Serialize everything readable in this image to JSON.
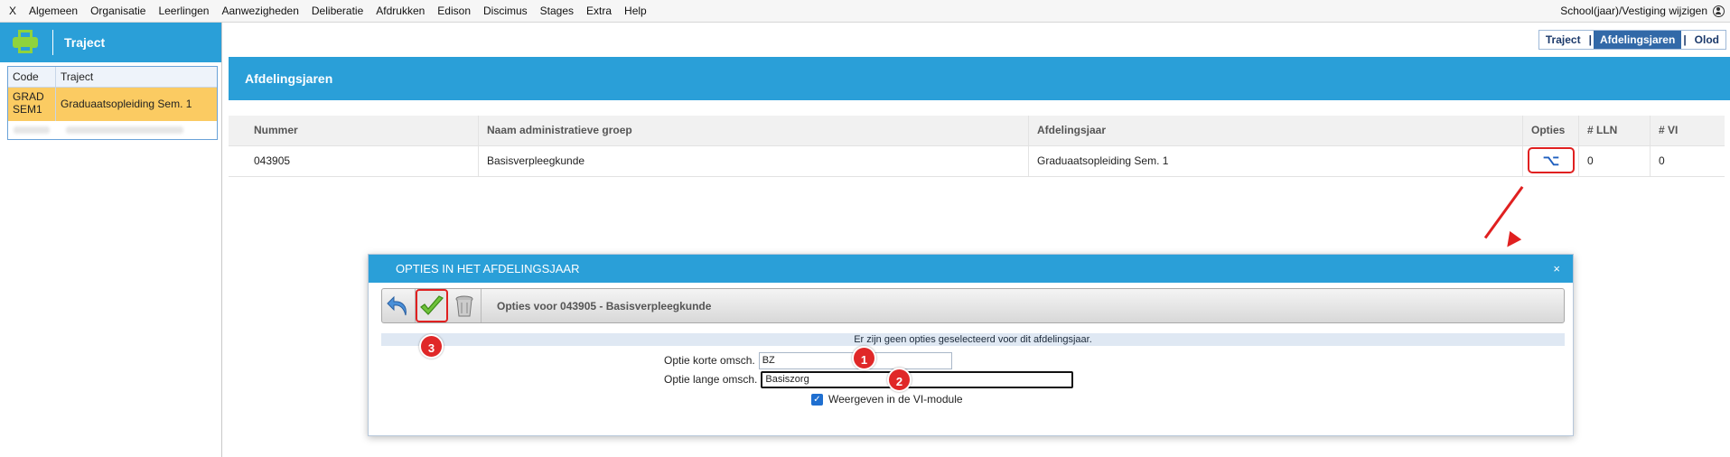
{
  "menu": {
    "items": [
      "X",
      "Algemeen",
      "Organisatie",
      "Leerlingen",
      "Aanwezigheden",
      "Deliberatie",
      "Afdrukken",
      "Edison",
      "Discimus",
      "Stages",
      "Extra",
      "Help"
    ],
    "right_label": "School(jaar)/Vestiging wijzigen"
  },
  "left": {
    "title": "Traject",
    "table": {
      "headers": [
        "Code",
        "Traject"
      ],
      "rows": [
        {
          "code": "GRAD SEM1",
          "traject": "Graduaatsopleiding Sem. 1"
        }
      ]
    }
  },
  "tabs": {
    "items": [
      "Traject",
      "Afdelingsjaren",
      "Olod"
    ],
    "active": "Afdelingsjaren"
  },
  "main": {
    "title": "Afdelingsjaren",
    "table": {
      "headers": [
        "Nummer",
        "Naam administratieve groep",
        "Afdelingsjaar",
        "Opties",
        "# LLN",
        "# VI"
      ],
      "rows": [
        {
          "nummer": "043905",
          "naam": "Basisverpleegkunde",
          "afdelingsjaar": "Graduaatsopleiding Sem. 1",
          "opties_icon": "⌥",
          "lln": "0",
          "vi": "0"
        }
      ]
    }
  },
  "dialog": {
    "title": "OPTIES IN HET AFDELINGSJAAR",
    "close": "×",
    "toolbar_label": "Opties voor 043905 - Basisverpleegkunde",
    "info": "Er zijn geen opties geselecteerd voor dit afdelingsjaar.",
    "short_label": "Optie korte omsch.",
    "short_value": "BZ",
    "long_label": "Optie lange omsch.",
    "long_value": "Basiszorg",
    "checkbox_label": "Weergeven in de VI-module",
    "checkbox_checked": true
  },
  "badges": [
    "1",
    "2",
    "3"
  ],
  "colors": {
    "accent": "#2a9fd8",
    "selected_row": "#fbcb62",
    "annotation": "#e02020",
    "tab_active": "#3269a8"
  }
}
